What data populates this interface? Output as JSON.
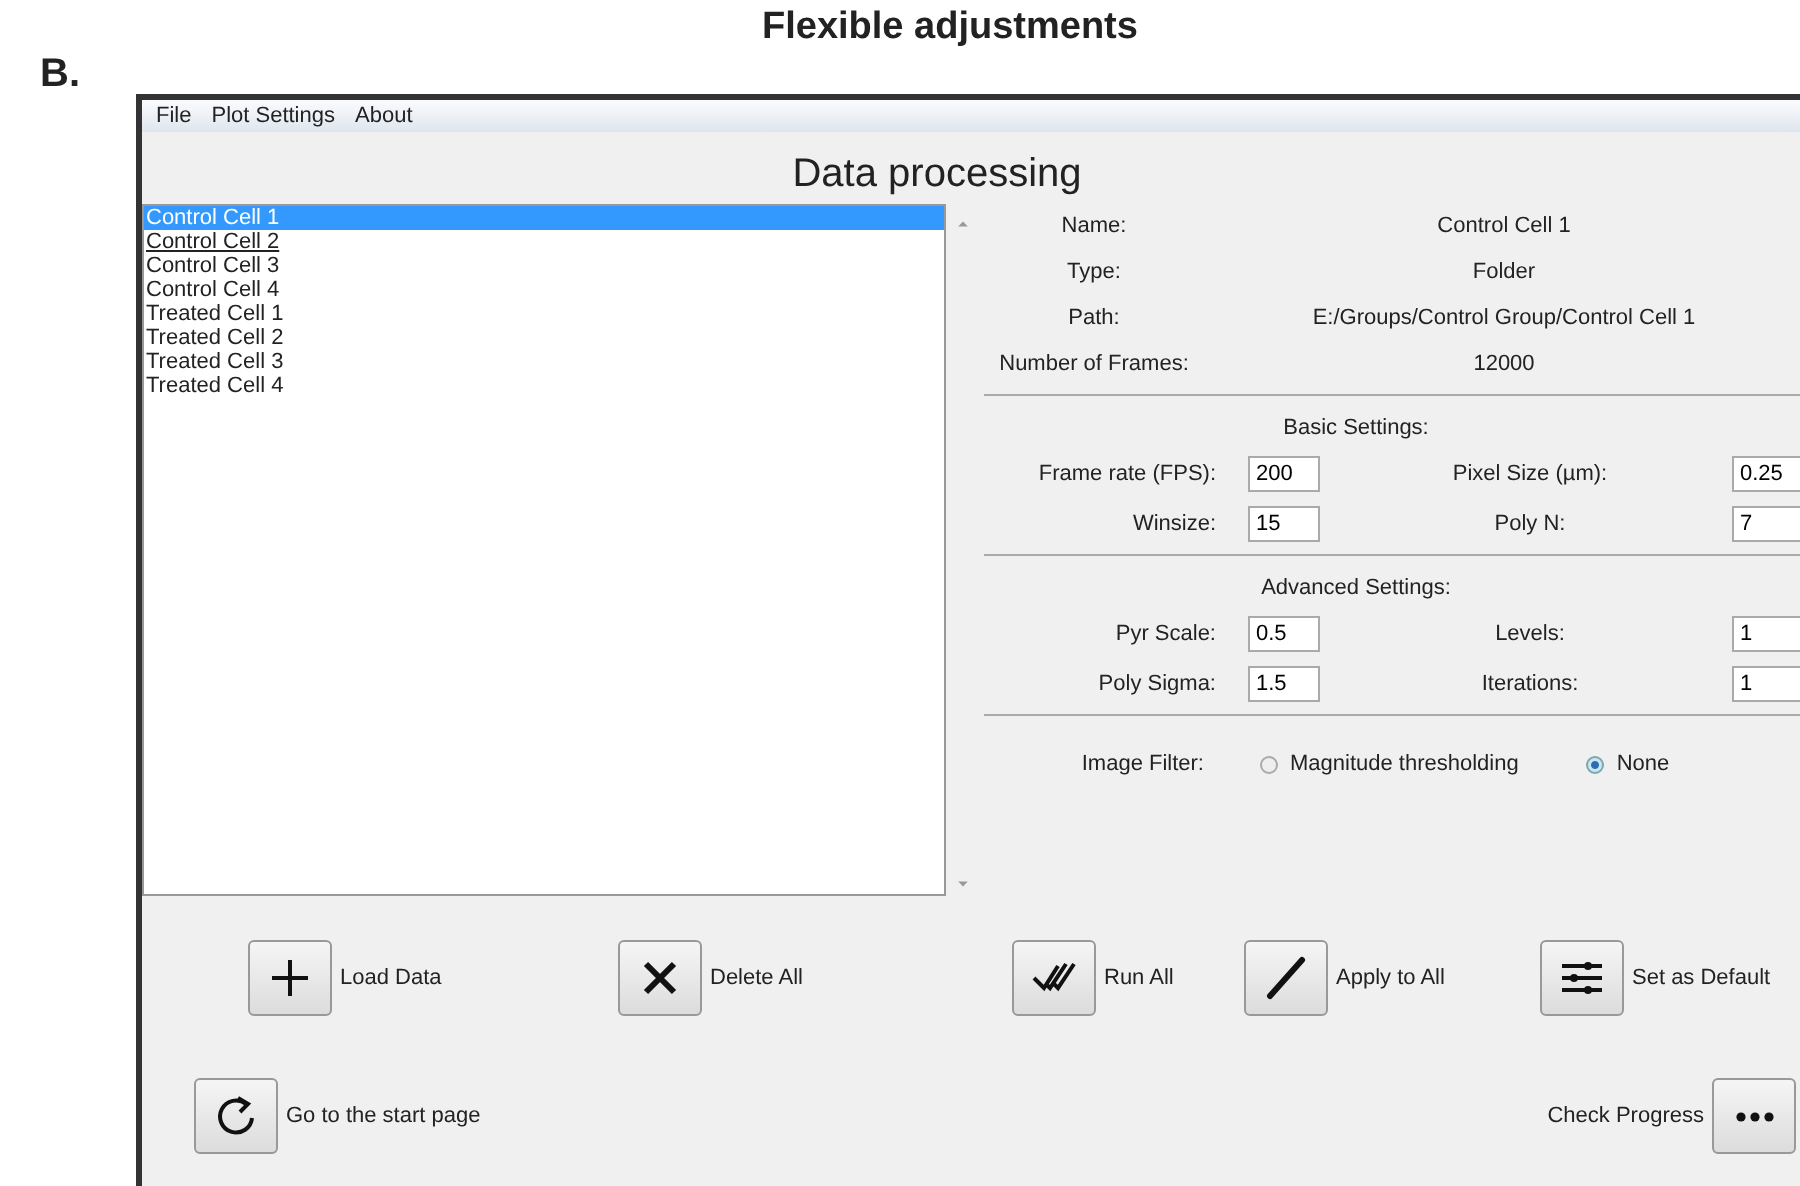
{
  "figure": {
    "panel_label": "B.",
    "title": "Flexible adjustments"
  },
  "menu": [
    "File",
    "Plot Settings",
    "About"
  ],
  "heading": "Data processing",
  "files": [
    {
      "label": "Control Cell 1",
      "selected": true,
      "focused": false
    },
    {
      "label": "Control Cell 2",
      "selected": false,
      "focused": true
    },
    {
      "label": "Control Cell 3",
      "selected": false,
      "focused": false
    },
    {
      "label": "Control Cell 4",
      "selected": false,
      "focused": false
    },
    {
      "label": "Treated Cell 1",
      "selected": false,
      "focused": false
    },
    {
      "label": "Treated Cell 2",
      "selected": false,
      "focused": false
    },
    {
      "label": "Treated Cell 3",
      "selected": false,
      "focused": false
    },
    {
      "label": "Treated Cell 4",
      "selected": false,
      "focused": false
    }
  ],
  "details": [
    {
      "label": "Name:",
      "value": "Control Cell 1"
    },
    {
      "label": "Type:",
      "value": "Folder"
    },
    {
      "label": "Path:",
      "value": "E:/Groups/Control Group/Control Cell 1"
    },
    {
      "label": "Number of Frames:",
      "value": "12000"
    }
  ],
  "sections": [
    {
      "title": "Basic Settings:",
      "fields": [
        {
          "label": "Frame rate (FPS):",
          "value": "200"
        },
        {
          "label": "Pixel Size (µm):",
          "value": "0.25"
        },
        {
          "label": "Winsize:",
          "value": "15"
        },
        {
          "label": "Poly N:",
          "value": "7"
        }
      ]
    },
    {
      "title": "Advanced Settings:",
      "fields": [
        {
          "label": "Pyr Scale:",
          "value": "0.5"
        },
        {
          "label": "Levels:",
          "value": "1"
        },
        {
          "label": "Poly Sigma:",
          "value": "1.5"
        },
        {
          "label": "Iterations:",
          "value": "1"
        }
      ]
    }
  ],
  "image_filter": {
    "label": "Image Filter:",
    "options": [
      {
        "label": "Magnitude thresholding",
        "selected": false
      },
      {
        "label": "None",
        "selected": true
      }
    ]
  },
  "actions": [
    {
      "label": "Load Data",
      "kind": "add"
    },
    {
      "label": "Delete All",
      "kind": "delete"
    },
    {
      "label": "Run All",
      "kind": "run"
    },
    {
      "label": "Apply to All",
      "kind": "apply"
    },
    {
      "label": "Set as Default",
      "kind": "default"
    }
  ],
  "footer": [
    {
      "label": "Go to the start page",
      "kind": "restart"
    },
    {
      "label": "Check Progress",
      "kind": "progress"
    }
  ]
}
